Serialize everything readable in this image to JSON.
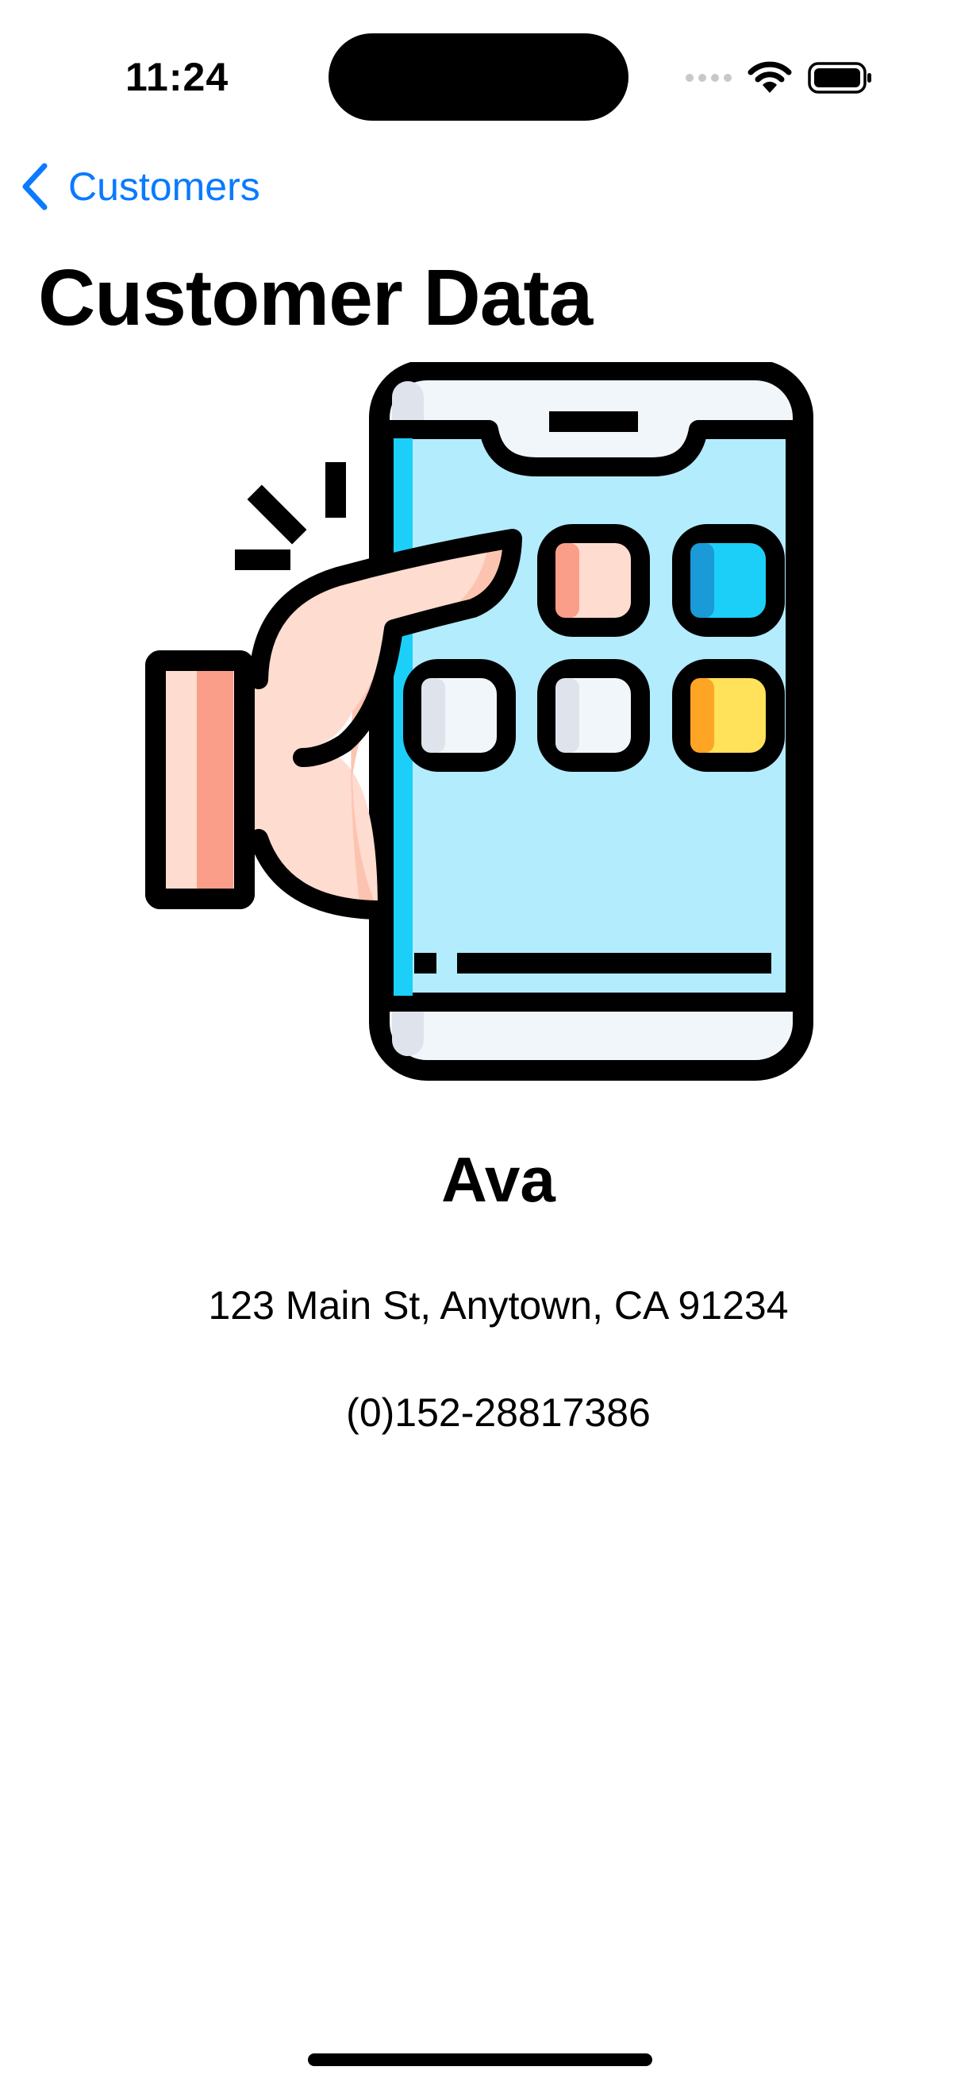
{
  "status_bar": {
    "time": "11:24",
    "icons": [
      "signal-dots-icon",
      "wifi-icon",
      "battery-icon"
    ]
  },
  "nav": {
    "back_label": "Customers",
    "back_icon": "chevron-left-icon"
  },
  "page_title": "Customer Data",
  "illustration": {
    "icon": "hand-tapping-smartphone-icon",
    "colors": {
      "screen": "#b3ecfc",
      "screen_edge": "#1ccff9",
      "frame": "#f1f6fa",
      "skin": "#fedccf",
      "skin_shadow": "#fa9e89",
      "blue_app": "#1ccff9",
      "yellow_app": "#ffe15a",
      "orange_app": "#ffa525"
    }
  },
  "customer": {
    "name": "Ava",
    "address": "123 Main St, Anytown, CA 91234",
    "phone": "(0)152-28817386"
  },
  "colors": {
    "accent": "#0a7aff",
    "background": "#ffffff",
    "text": "#000000"
  }
}
